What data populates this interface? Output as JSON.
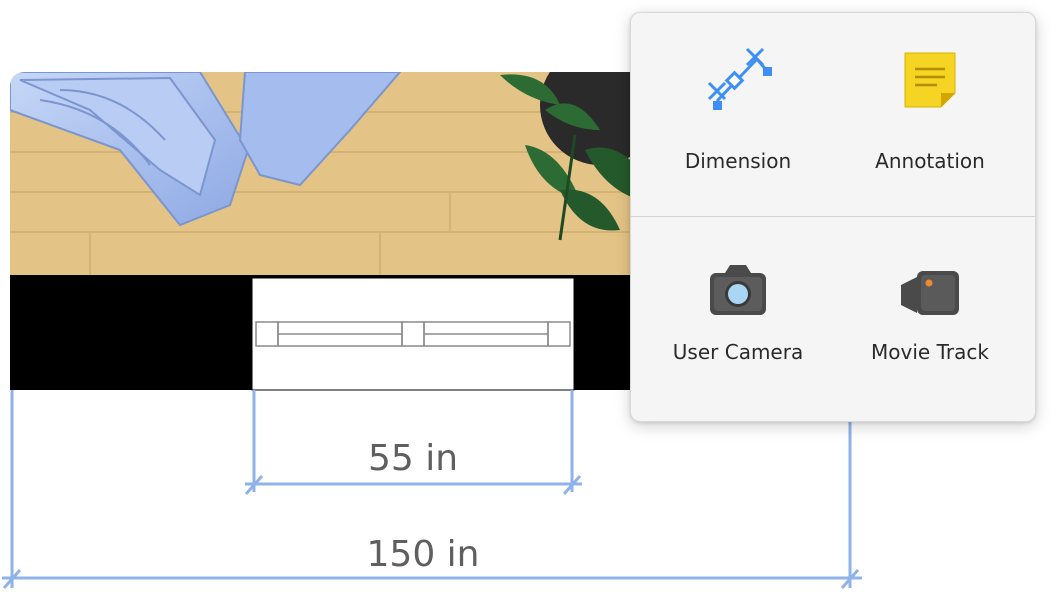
{
  "dimensions": {
    "inner_label": "55 in",
    "outer_label": "150 in",
    "line_color": "#8fb3e8"
  },
  "popover": {
    "tools": [
      {
        "label": "Dimension",
        "icon": "dimension-icon",
        "accent": "#3d8ff5"
      },
      {
        "label": "Annotation",
        "icon": "annotation-note-icon",
        "accent": "#f5d423"
      },
      {
        "label": "User Camera",
        "icon": "camera-icon",
        "accent": "#a9d6f5"
      },
      {
        "label": "Movie Track",
        "icon": "movie-camera-icon",
        "accent": "#f08a2e"
      }
    ]
  },
  "scene": {
    "floor_color": "#e3c486",
    "sofa_color": "#a8c2f0",
    "plant_color": "#2d6b34"
  }
}
